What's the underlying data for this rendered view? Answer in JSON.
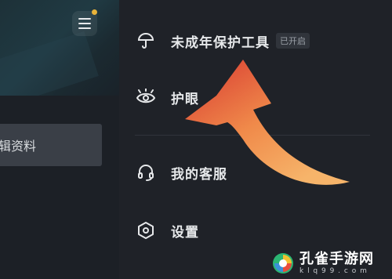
{
  "left": {
    "edit_profile_label": "辑资料"
  },
  "menu": {
    "items": [
      {
        "label": "未成年保护工具",
        "badge": "已开启",
        "icon": "umbrella-icon"
      },
      {
        "label": "护眼",
        "icon": "eye-icon"
      },
      {
        "label": "我的客服",
        "icon": "headset-icon"
      },
      {
        "label": "设置",
        "icon": "settings-hexagon-icon"
      }
    ]
  },
  "overlay": {
    "arrow_colors": [
      "#e0553a",
      "#f08a4a",
      "#f6b46a"
    ]
  },
  "watermark": {
    "title": "孔雀手游网",
    "url": "k l q 9 9 . c o m"
  },
  "colors": {
    "notification_dot": "#e8b33a",
    "background": "#1f2228"
  }
}
